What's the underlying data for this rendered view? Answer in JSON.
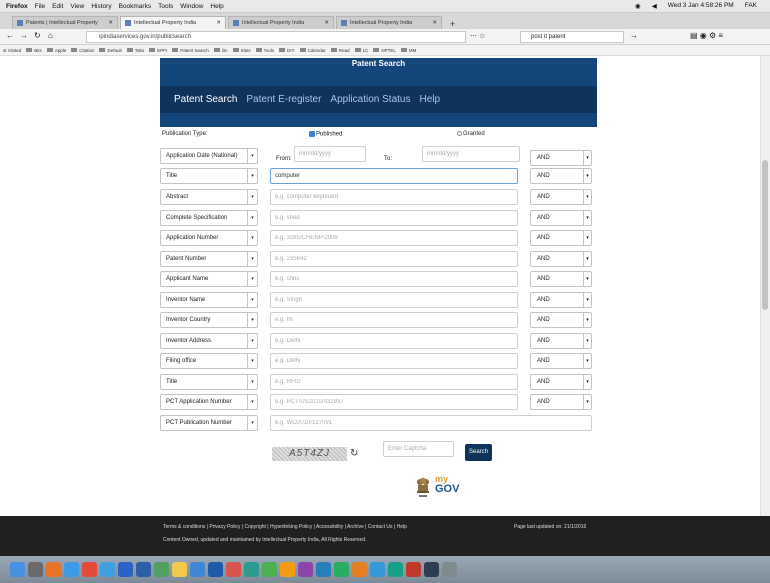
{
  "menubar": {
    "items": [
      "Firefox",
      "File",
      "Edit",
      "View",
      "History",
      "Bookmarks",
      "Tools",
      "Window",
      "Help"
    ],
    "clock": "Wed 3 Jan 4:58:26 PM",
    "user": "FAK"
  },
  "tabs": [
    {
      "label": "Patents | Intellectual Property"
    },
    {
      "label": "Intellectual Property India"
    },
    {
      "label": "Intellectual Property India"
    },
    {
      "label": "Intellectual Property India"
    }
  ],
  "url": "ipindiaservices.gov.in/publicsearch",
  "browser_search": "post it patent",
  "bookmarks": [
    "st Visited",
    "Bits",
    "Apple",
    "Citation",
    "Default",
    "Tabs",
    "EPFI",
    "Patent Search",
    "lim",
    "Sites",
    "Tools",
    "DIY",
    "Calendar",
    "Read",
    "LC",
    "NPTEL",
    "MM"
  ],
  "banner": {
    "title": "Patent Search"
  },
  "nav": [
    "Patent Search",
    "Patent E-register",
    "Application Status",
    "Help"
  ],
  "form": {
    "publication_type_label": "Publication Type:",
    "published_label": "Published",
    "granted_label": "Granted",
    "date_field": "Application Date (National)",
    "from_label": "From:",
    "to_label": "To:",
    "date_placeholder": "mm/dd/yyyy",
    "operator": "AND",
    "rows": [
      {
        "field": "Title",
        "value": "computer",
        "placeholder": ""
      },
      {
        "field": "Abstract",
        "value": "",
        "placeholder": "e.g. computer keyboard"
      },
      {
        "field": "Complete Specification",
        "value": "",
        "placeholder": "e.g. shed"
      },
      {
        "field": "Application Number",
        "value": "",
        "placeholder": "e.g. 3285/CHENP/2008"
      },
      {
        "field": "Patent Number",
        "value": "",
        "placeholder": "e.g. 235642"
      },
      {
        "field": "Applicant Name",
        "value": "",
        "placeholder": "e.g. chris"
      },
      {
        "field": "Inventor Name",
        "value": "",
        "placeholder": "e.g. Singh"
      },
      {
        "field": "Inventor Country",
        "value": "",
        "placeholder": "e.g. IN"
      },
      {
        "field": "Inventor Address",
        "value": "",
        "placeholder": "e.g. Delhi"
      },
      {
        "field": "Filing office",
        "value": "",
        "placeholder": "e.g. Delhi"
      },
      {
        "field": "Title",
        "value": "",
        "placeholder": "e.g. RFID"
      },
      {
        "field": "PCT Application Number",
        "value": "",
        "placeholder": "e.g. PCT/US2010/032937"
      },
      {
        "field": "PCT Publication Number",
        "value": "",
        "placeholder": "e.g. WO2010/127091"
      }
    ],
    "captcha_text": "A5T4ZJ",
    "captcha_placeholder": "Enter Captcha",
    "search_button": "Search"
  },
  "mygov": {
    "my": "my",
    "gov": "GOV"
  },
  "footer": {
    "links": "Terms & conditions | Privacy Policy | Copyright | Hyperlinking Policy | Accessibility | Archive | Contact Us | Help",
    "copyright": "Content Owned, updated and maintained by Intellectual Property India, All Rights Reserved.",
    "updated": "Page last updated on: 21/1/2016"
  },
  "colors": {
    "banner": "#14467b",
    "nav": "#10335b",
    "footer": "#202020"
  }
}
